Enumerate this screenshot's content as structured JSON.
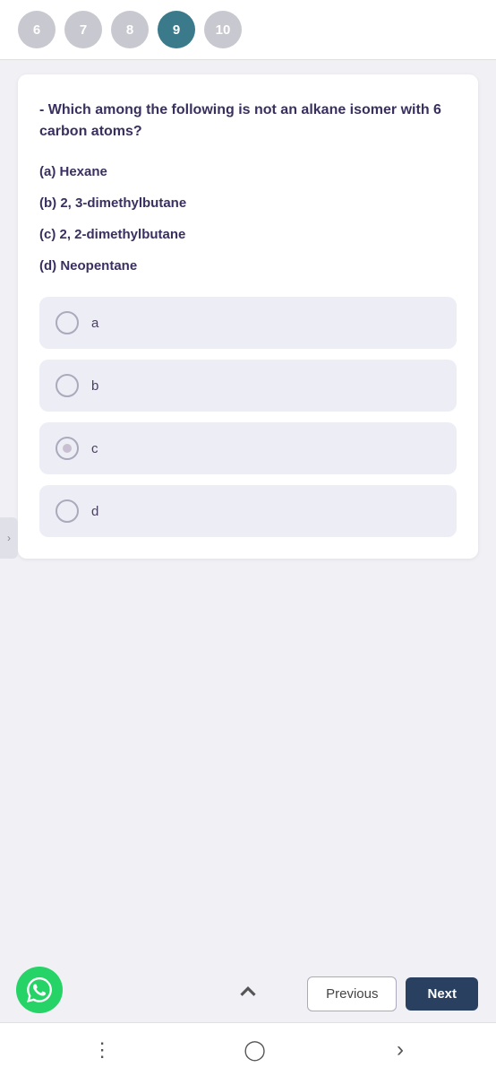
{
  "colors": {
    "accent_teal": "#3a7a8a",
    "accent_purple": "#3a3060",
    "option_bg": "#ecedf5",
    "nav_circle_default": "#c0c0cc",
    "whatsapp_green": "#25d366",
    "pink_red": "#e01060",
    "btn_next_bg": "#2a4050"
  },
  "top_nav": {
    "circles": [
      {
        "label": "6",
        "state": "default"
      },
      {
        "label": "7",
        "state": "default"
      },
      {
        "label": "8",
        "state": "default"
      },
      {
        "label": "9",
        "state": "active"
      },
      {
        "label": "10",
        "state": "default"
      }
    ]
  },
  "question": {
    "text": "- Which among the following is not an alkane isomer with 6 carbon atoms?",
    "options": [
      {
        "key": "a",
        "label": "(a) Hexane"
      },
      {
        "key": "b",
        "label": "(b) 2, 3-dimethylbutane"
      },
      {
        "key": "c",
        "label": "(c) 2, 2-dimethylbutane"
      },
      {
        "key": "d",
        "label": "(d) Neopentane"
      }
    ],
    "choices": [
      {
        "id": "a",
        "letter": "a"
      },
      {
        "id": "b",
        "letter": "b"
      },
      {
        "id": "c",
        "letter": "c",
        "partially_selected": true
      },
      {
        "id": "d",
        "letter": "d"
      }
    ]
  },
  "buttons": {
    "previous_label": "Previous",
    "next_label": "Next"
  },
  "bottom_nav": {
    "items": [
      "≡",
      "○",
      "›"
    ]
  }
}
